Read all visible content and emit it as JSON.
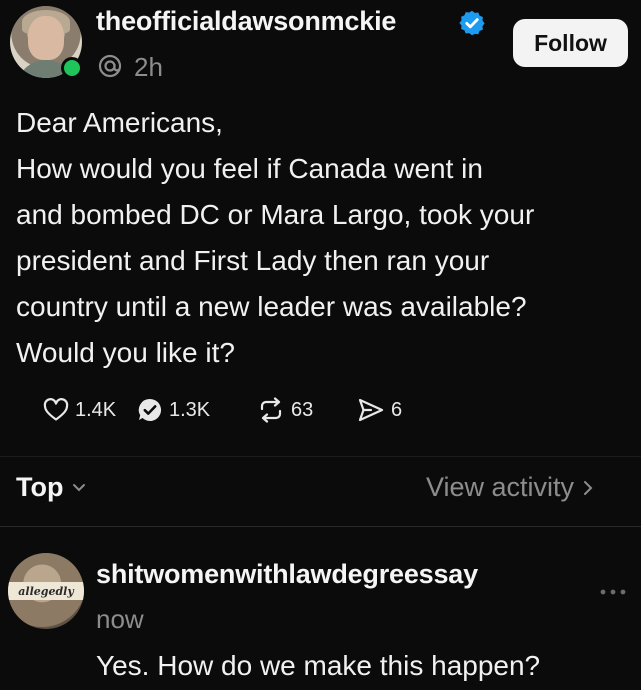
{
  "post": {
    "author": {
      "username": "theofficialdawsonmckie",
      "verified": true,
      "online": true
    },
    "time_label": "2h",
    "follow_label": "Follow",
    "lines": [
      "Dear Americans,",
      "How would you feel if Canada went in",
      "and bombed DC or Mara Largo, took your",
      "president and First Lady then ran your",
      "country until a new leader was available?",
      "Would you like it?"
    ],
    "actions": {
      "likes": "1.4K",
      "comments": "1.3K",
      "reposts": "63",
      "shares": "6"
    }
  },
  "sort": {
    "label": "Top",
    "view_activity": "View activity"
  },
  "reply": {
    "username": "shitwomenwithlawdegreessay",
    "avatar_caption": "allegedly",
    "time_label": "now",
    "text": "Yes. How do we make this happen?"
  },
  "colors": {
    "background": "#0b0b0b",
    "text": "#f1f1f1",
    "muted": "#8d8d8d",
    "verified": "#1d9bf0",
    "online": "#1fc55a",
    "follow_bg": "#f3f3f3"
  }
}
